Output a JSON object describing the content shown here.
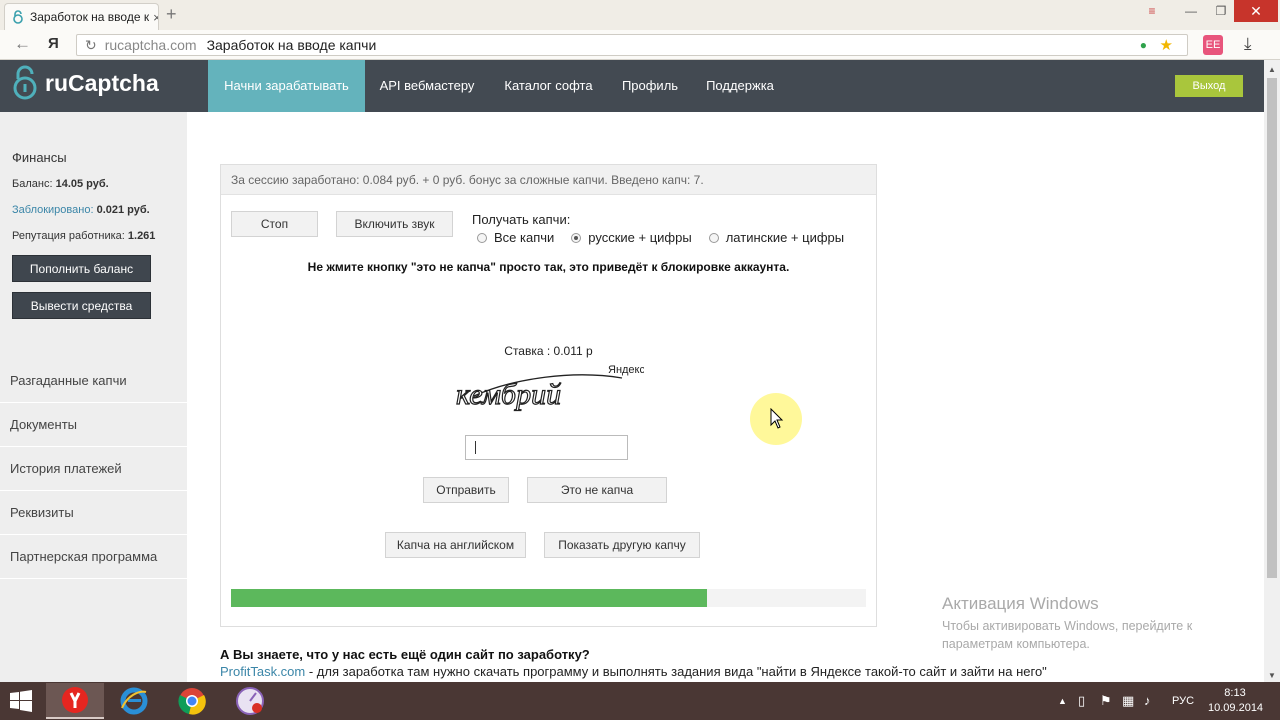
{
  "browser": {
    "tab_title": "Заработок на вводе к",
    "tab_close": "×",
    "new_tab": "+",
    "ya_button": "Я",
    "domain": "rucaptcha.com",
    "page_title": "Заработок на вводе капчи",
    "window_menu": "≡",
    "minimize": "—",
    "maximize": "❐",
    "close": "✕",
    "extension_label": "ЕЕ"
  },
  "site": {
    "brand": "ruCaptcha",
    "nav": [
      {
        "label": "Начни зарабатывать",
        "active": true
      },
      {
        "label": "API вебмастеру",
        "active": false
      },
      {
        "label": "Каталог софта",
        "active": false
      },
      {
        "label": "Профиль",
        "active": false
      },
      {
        "label": "Поддержка",
        "active": false
      }
    ],
    "logout": "Выход"
  },
  "sidebar": {
    "finance_title": "Финансы",
    "balance_label": "Баланс:",
    "balance_value": "14.05 руб.",
    "blocked_label": "Заблокировано:",
    "blocked_value": "0.021 руб.",
    "reputation_label": "Репутация работника:",
    "reputation_value": "1.261",
    "topup_button": "Пополнить баланс",
    "withdraw_button": "Вывести средства",
    "links": [
      "Разгаданные капчи",
      "Документы",
      "История платежей",
      "Реквизиты",
      "Партнерская программа"
    ]
  },
  "work": {
    "session_text": "За сессию заработано: 0.084 руб. + 0 руб. бонус за сложные капчи. Введено капч: 7.",
    "stop_button": "Стоп",
    "sound_button": "Включить звук",
    "receive_label": "Получать капчи:",
    "options": [
      {
        "label": "Все капчи",
        "checked": false
      },
      {
        "label": "русские + цифры",
        "checked": true
      },
      {
        "label": "латинские + цифры",
        "checked": false
      }
    ],
    "warning": "Не жмите кнопку \"это не капча\" просто так, это приведёт к блокировке аккаунта.",
    "rate": "Ставка : 0.011 р",
    "captcha_word": "кембрий",
    "captcha_brand": "Яндекс",
    "answer_value": "",
    "submit_button": "Отправить",
    "not_captcha_button": "Это не капча",
    "english_button": "Капча на английском",
    "another_button": "Показать другую капчу",
    "progress": 0.75
  },
  "promo": {
    "question": "А Вы знаете, что у нас есть ещё один сайт по заработку?",
    "link": "ProfitTask.com",
    "text": " - для заработка там нужно скачать программу и выполнять задания вида \"найти в Яндексе такой-то сайт и зайти на него\""
  },
  "activation": {
    "title": "Активация Windows",
    "text": "Чтобы активировать Windows, перейдите к параметрам компьютера."
  },
  "taskbar": {
    "language": "РУС",
    "time": "8:13",
    "date": "10.09.2014"
  },
  "colors": {
    "header_bg": "#434a52",
    "nav_active": "#64b3bc",
    "logout_bg": "#a9c63c",
    "progress_fill": "#5cb85c",
    "link": "#3b86a8",
    "taskbar_bg": "#4a3734"
  }
}
